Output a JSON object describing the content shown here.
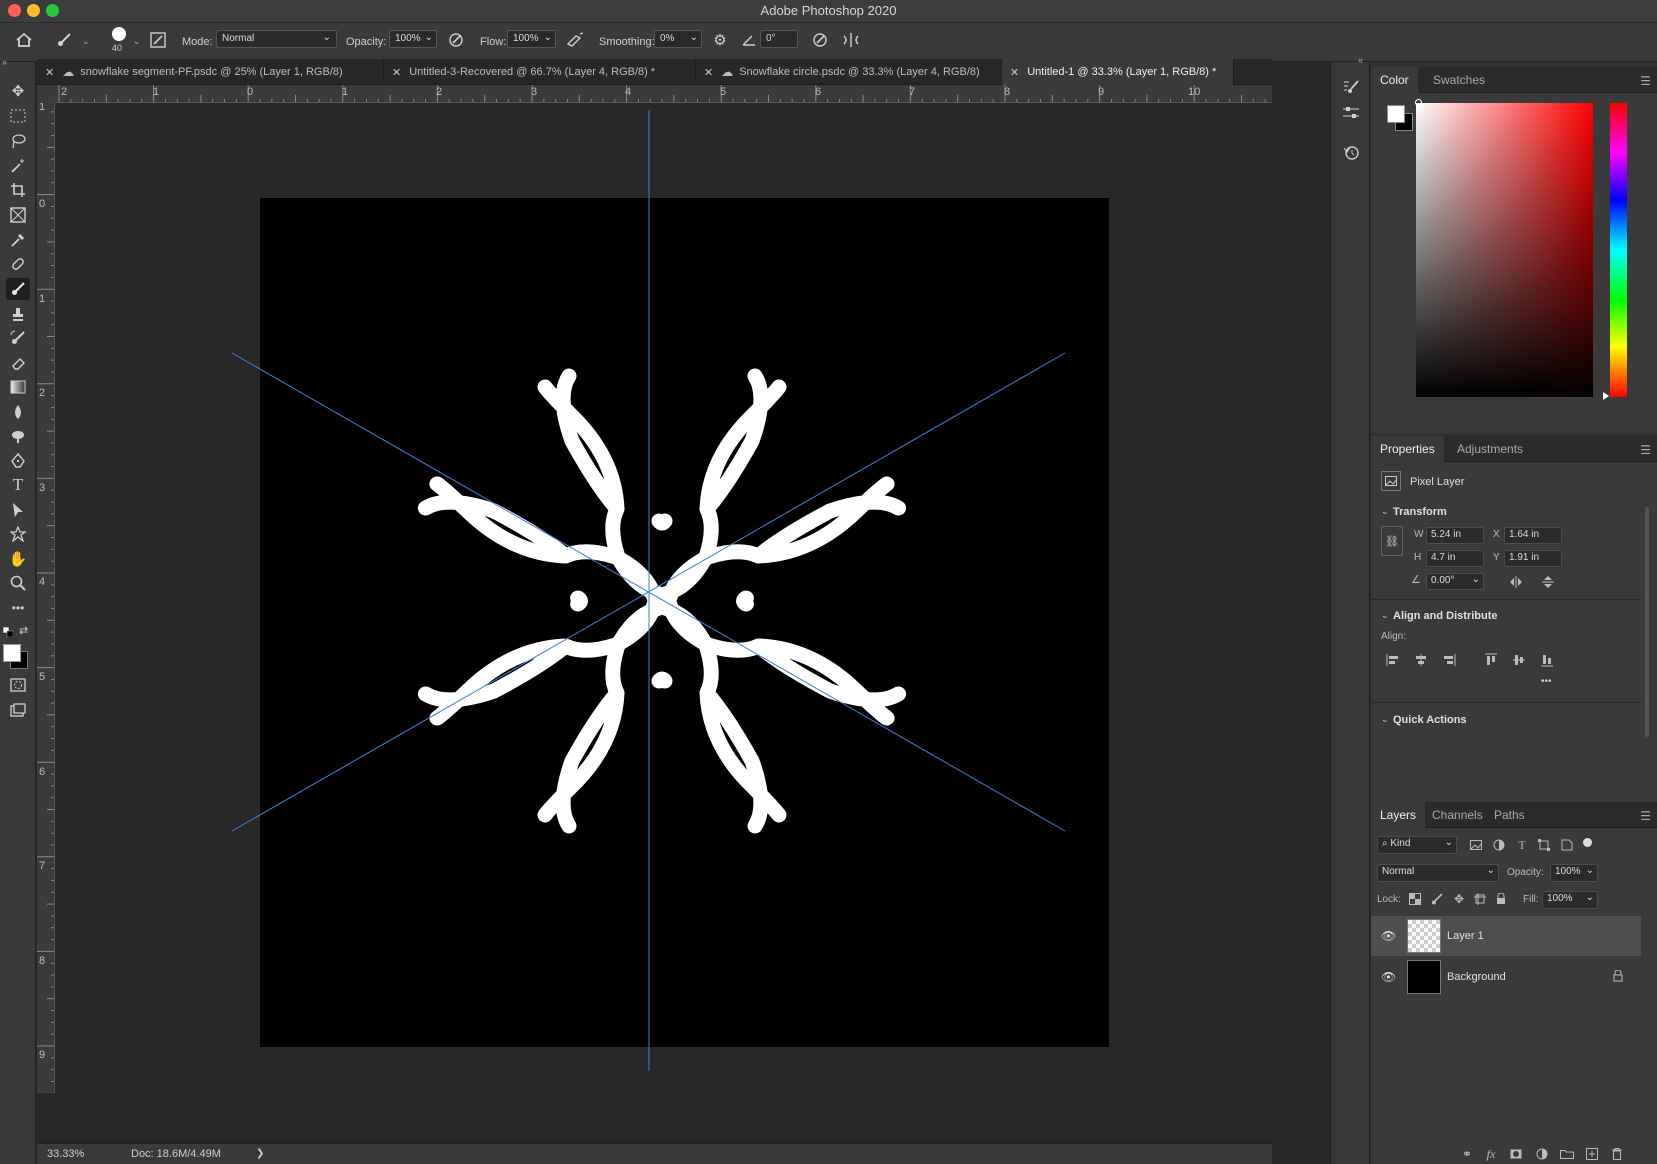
{
  "app": {
    "title": "Adobe Photoshop 2020"
  },
  "options": {
    "brush_size": "40",
    "mode_label": "Mode:",
    "mode_value": "Normal",
    "opacity_label": "Opacity:",
    "opacity_value": "100%",
    "flow_label": "Flow:",
    "flow_value": "100%",
    "smoothing_label": "Smoothing:",
    "smoothing_value": "0%",
    "angle_value": "0°"
  },
  "tabs": [
    {
      "label": "snowflake segment-PF.psdc @ 25% (Layer 1, RGB/8)",
      "cloud": true,
      "active": false
    },
    {
      "label": "Untitled-3-Recovered @ 66.7% (Layer 4, RGB/8) *",
      "cloud": false,
      "active": false
    },
    {
      "label": "Snowflake circle.psdc @ 33.3% (Layer 4, RGB/8)",
      "cloud": true,
      "active": false
    },
    {
      "label": "Untitled-1 @ 33.3% (Layer 1, RGB/8) *",
      "cloud": false,
      "active": true
    }
  ],
  "ruler": {
    "top": [
      "2",
      "1",
      "0",
      "1",
      "2",
      "3",
      "4",
      "5",
      "6",
      "7",
      "8",
      "9",
      "10"
    ],
    "left": [
      "1",
      "0",
      "1",
      "2",
      "3",
      "4",
      "5",
      "6",
      "7",
      "8",
      "9"
    ]
  },
  "status": {
    "zoom": "33.33%",
    "doc": "Doc: 18.6M/4.49M",
    "arrow": "❯"
  },
  "color_panel": {
    "tabs": [
      "Color",
      "Swatches"
    ]
  },
  "properties_panel": {
    "tabs": [
      "Properties",
      "Adjustments"
    ],
    "layer_type": "Pixel Layer",
    "transform_title": "Transform",
    "w_label": "W",
    "w_value": "5.24 in",
    "h_label": "H",
    "h_value": "4.7 in",
    "x_label": "X",
    "x_value": "1.64 in",
    "y_label": "Y",
    "y_value": "1.91 in",
    "angle_value": "0.00°",
    "align_title": "Align and Distribute",
    "align_label": "Align:",
    "more": "•••",
    "quick_actions_title": "Quick Actions"
  },
  "layers_panel": {
    "tabs": [
      "Layers",
      "Channels",
      "Paths"
    ],
    "filter_kind": "Kind",
    "blend_mode": "Normal",
    "opacity_label": "Opacity:",
    "opacity_value": "100%",
    "lock_label": "Lock:",
    "fill_label": "Fill:",
    "fill_value": "100%",
    "layers": [
      {
        "name": "Layer 1",
        "selected": true,
        "locked": false
      },
      {
        "name": "Background",
        "selected": false,
        "locked": true
      }
    ]
  },
  "colors": {
    "foreground": "#ffffff",
    "background": "#000000",
    "guide": "#3f7fd6"
  }
}
